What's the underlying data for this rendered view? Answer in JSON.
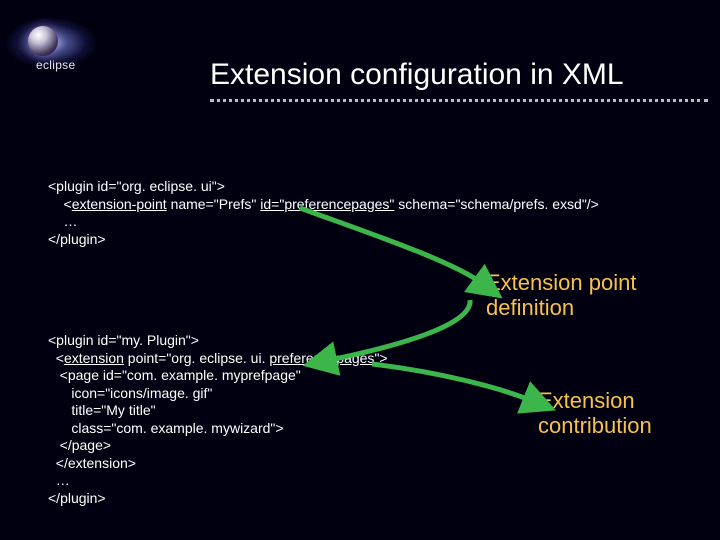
{
  "brand": "eclipse",
  "title": "Extension configuration in XML",
  "code_block_1": {
    "l1a": "<plugin id=\"org. eclipse. ui\">",
    "l2_indent": "    <",
    "l2_ep": "extension-point",
    "l2_rest": " name=\"Prefs\" ",
    "l2_id": "id=\"preferencepages\"",
    "l2_after": " schema=\"schema/prefs. exsd\"/>",
    "l3": "    …",
    "l4": "</plugin>"
  },
  "label_definition_l1": "Extension point",
  "label_definition_l2": "definition",
  "code_block_2": {
    "l1": "<plugin id=\"my. Plugin\">",
    "l2a": "  <",
    "l2b": "extension",
    "l2c": " point=\"org. eclipse. ui. ",
    "l2d": "preferencepages",
    "l2e": "\">",
    "l3": "   <page id=\"com. example. myprefpage\"",
    "l4": "      icon=\"icons/image. gif\"",
    "l5": "      title=\"My title\"",
    "l6": "      class=\"com. example. mywizard\">",
    "l7": "   </page>",
    "l8": "  </extension>",
    "l9": "  …",
    "l10": "</plugin>"
  },
  "label_contribution_l1": "Extension",
  "label_contribution_l2": "contribution"
}
